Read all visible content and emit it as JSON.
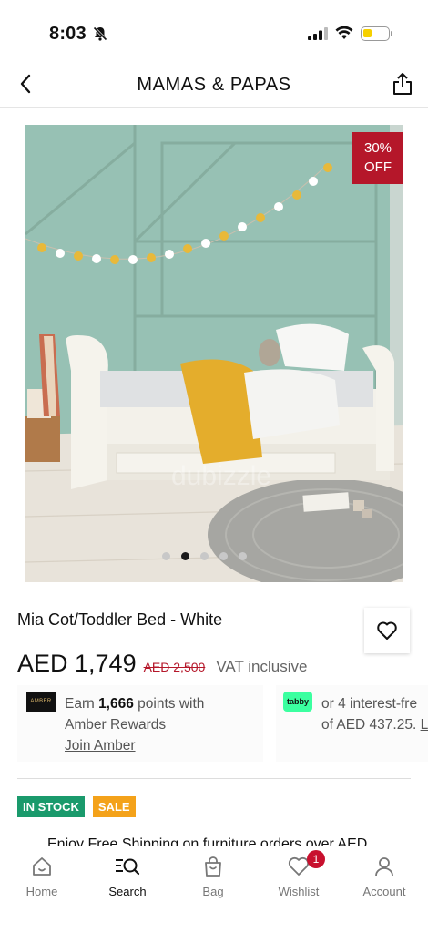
{
  "status": {
    "time": "8:03",
    "battery_level": 0.35,
    "battery_color": "#f6d000"
  },
  "nav": {
    "brand": "MAMAS & PAPAS"
  },
  "gallery": {
    "discount_label": "30% OFF",
    "discount_line1": "30%",
    "discount_line2": "OFF",
    "total_images": 5,
    "active_index": 1
  },
  "product": {
    "title": "Mia Cot/Toddler Bed - White",
    "price": "AED 1,749",
    "old_price": "AED 2,500",
    "vat": "VAT inclusive"
  },
  "amber": {
    "logo": "AMBER",
    "earn_prefix": "Earn ",
    "points": "1,666",
    "earn_suffix": " points with",
    "line2": "Amber Rewards",
    "join": "Join Amber"
  },
  "tabby": {
    "logo": "tabby",
    "line1": "or 4 interest-fre",
    "line2_prefix": "of AED 437.25. ",
    "link": "Le"
  },
  "badges": {
    "stock": "IN STOCK",
    "sale": "SALE"
  },
  "shipping": {
    "text": "Enjoy Free Shipping on furniture orders over AED"
  },
  "tabs": [
    {
      "label": "Home",
      "icon": "home-icon"
    },
    {
      "label": "Search",
      "icon": "search-icon"
    },
    {
      "label": "Bag",
      "icon": "bag-icon"
    },
    {
      "label": "Wishlist",
      "icon": "heart-icon",
      "count": "1"
    },
    {
      "label": "Account",
      "icon": "account-icon"
    }
  ],
  "colors": {
    "sale_red": "#b5172a",
    "stock_green": "#1a9a6c",
    "sale_orange": "#f4a21a",
    "wish_badge": "#c8102e"
  }
}
